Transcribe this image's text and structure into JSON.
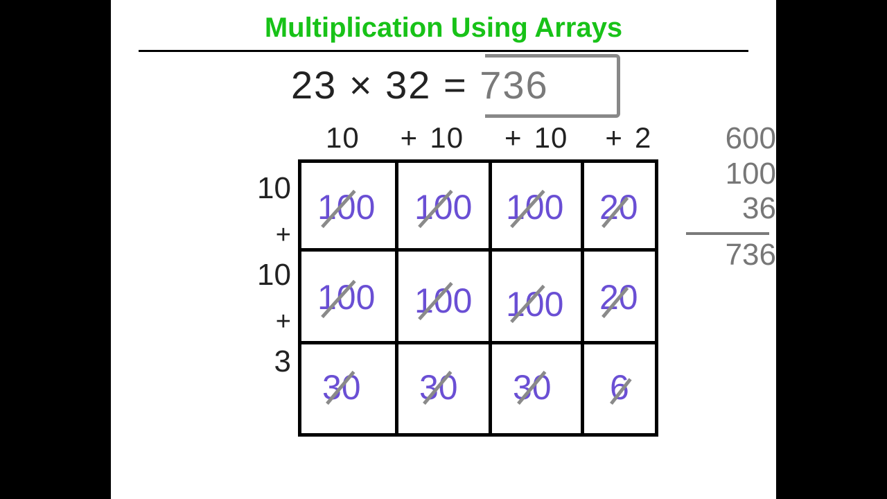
{
  "title": "Multiplication Using Arrays",
  "equation": {
    "lhs": "23 × 32",
    "eq": "=",
    "answer": "736"
  },
  "columns": [
    "10",
    "+",
    "10",
    "+",
    "10",
    "+",
    "2"
  ],
  "rows": [
    "10",
    "+",
    "10",
    "+",
    "3"
  ],
  "grid": [
    [
      "100",
      "100",
      "100",
      "20"
    ],
    [
      "100",
      "100",
      "100",
      "20"
    ],
    [
      "30",
      "30",
      "30",
      "6"
    ]
  ],
  "sum": {
    "addends": [
      "600",
      "100",
      "36"
    ],
    "total": "736"
  },
  "chart_data": {
    "type": "table",
    "title": "Area-model multiplication 23 × 32",
    "row_labels": [
      "10",
      "10",
      "3"
    ],
    "col_labels": [
      "10",
      "10",
      "10",
      "2"
    ],
    "cells": [
      [
        100,
        100,
        100,
        20
      ],
      [
        100,
        100,
        100,
        20
      ],
      [
        30,
        30,
        30,
        6
      ]
    ],
    "partial_sums": [
      600,
      100,
      36
    ],
    "product": 736
  }
}
